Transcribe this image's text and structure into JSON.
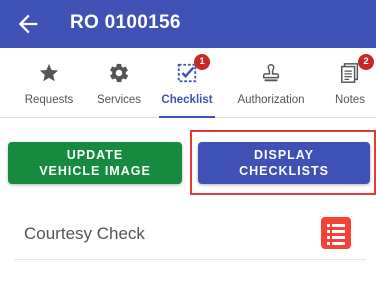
{
  "appbar": {
    "title": "RO 0100156",
    "back_icon": "arrow-left-icon",
    "color": "#3f51b5"
  },
  "tabs": [
    {
      "label": "Requests",
      "icon": "star-icon"
    },
    {
      "label": "Services",
      "icon": "gear-icon"
    },
    {
      "label": "Checklist",
      "icon": "checklist-icon",
      "badge": "1",
      "active": true
    },
    {
      "label": "Authorization",
      "icon": "stamp-icon"
    },
    {
      "label": "Notes",
      "icon": "notes-icon",
      "badge": "2"
    }
  ],
  "buttons": {
    "update_vehicle_image": "UPDATE VEHICLE IMAGE",
    "display_checklists": "DISPLAY CHECKLISTS"
  },
  "checklist_items": [
    {
      "label": "Courtesy Check",
      "icon": "list-icon"
    }
  ],
  "colors": {
    "accent": "#3f51b5",
    "green": "#168b3f",
    "badge": "#c62828",
    "highlight": "#e53935",
    "list_icon": "#f44336"
  }
}
